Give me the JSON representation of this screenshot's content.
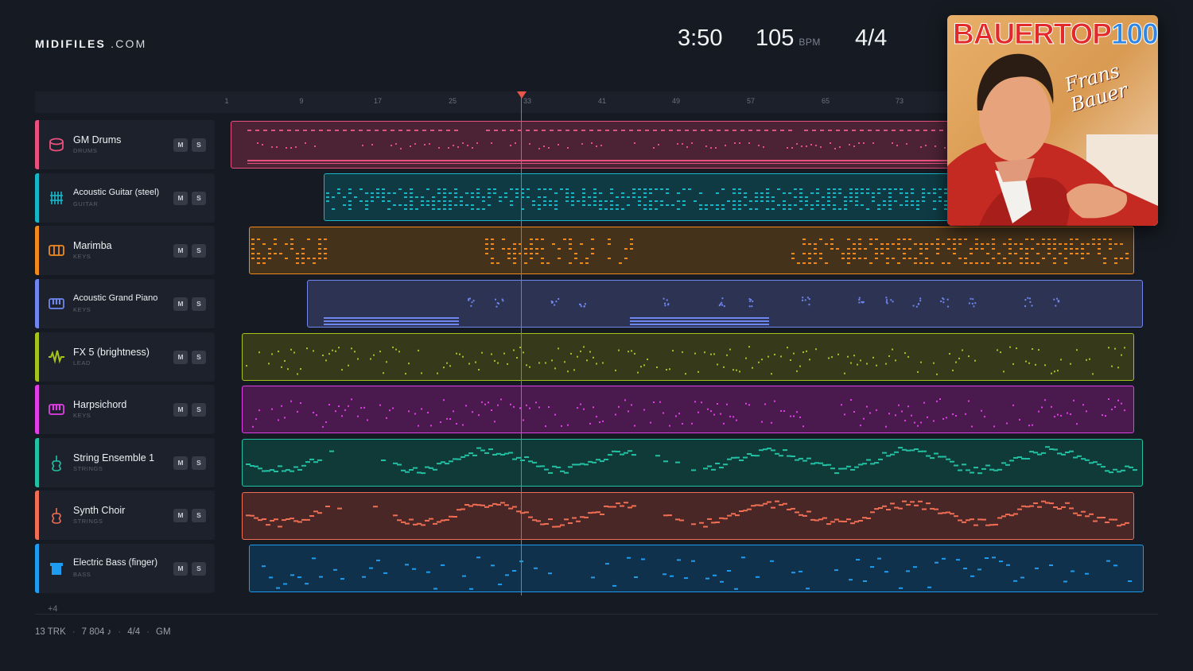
{
  "brand": {
    "name_bold": "MIDIFILES",
    "name_light": ".COM"
  },
  "header": {
    "duration": "3:50",
    "tempo": "105",
    "tempo_unit": "BPM",
    "time_signature": "4/4"
  },
  "album_cover": {
    "title_part1": "BAUER",
    "title_part2": "TOP",
    "title_number": "100",
    "artist_script": "Frans Bauer"
  },
  "ruler": {
    "bar_numbers": [
      "1",
      "9",
      "17",
      "25",
      "33",
      "41",
      "49",
      "57",
      "65",
      "73"
    ]
  },
  "playhead": {
    "bar": 33
  },
  "tracks": [
    {
      "name": "GM Drums",
      "category": "DRUMS",
      "icon": "drum-icon",
      "color": "#e8507e",
      "fill": "#4b2334",
      "mute": "M",
      "solo": "S"
    },
    {
      "name": "Acoustic Guitar (steel)",
      "category": "GUITAR",
      "icon": "guitar-icon",
      "color": "#17b6c7",
      "fill": "#0f3a44",
      "mute": "M",
      "solo": "S"
    },
    {
      "name": "Marimba",
      "category": "KEYS",
      "icon": "marimba-icon",
      "color": "#f08a1c",
      "fill": "#45321b",
      "mute": "M",
      "solo": "S"
    },
    {
      "name": "Acoustic Grand Piano",
      "category": "KEYS",
      "icon": "piano-icon",
      "color": "#6f86ef",
      "fill": "#2c3353",
      "mute": "M",
      "solo": "S"
    },
    {
      "name": "FX 5 (brightness)",
      "category": "LEAD",
      "icon": "waveform-icon",
      "color": "#a6c21d",
      "fill": "#36391a",
      "mute": "M",
      "solo": "S"
    },
    {
      "name": "Harpsichord",
      "category": "KEYS",
      "icon": "keyboard-icon",
      "color": "#e23ee7",
      "fill": "#4a1a4e",
      "mute": "M",
      "solo": "S"
    },
    {
      "name": "String Ensemble 1",
      "category": "STRINGS",
      "icon": "violin-icon",
      "color": "#22c1a4",
      "fill": "#0f3a37",
      "mute": "M",
      "solo": "S"
    },
    {
      "name": "Synth Choir",
      "category": "STRINGS",
      "icon": "choir-icon",
      "color": "#f06e53",
      "fill": "#4a2727",
      "mute": "M",
      "solo": "S"
    },
    {
      "name": "Electric Bass (finger)",
      "category": "BASS",
      "icon": "bass-icon",
      "color": "#1d9cf0",
      "fill": "#10314b",
      "mute": "M",
      "solo": "S"
    }
  ],
  "more_tracks": "+4",
  "footer": {
    "tracks": "13 TRK",
    "notes": "7 804 ♪",
    "time_signature": "4/4",
    "standard": "GM"
  }
}
